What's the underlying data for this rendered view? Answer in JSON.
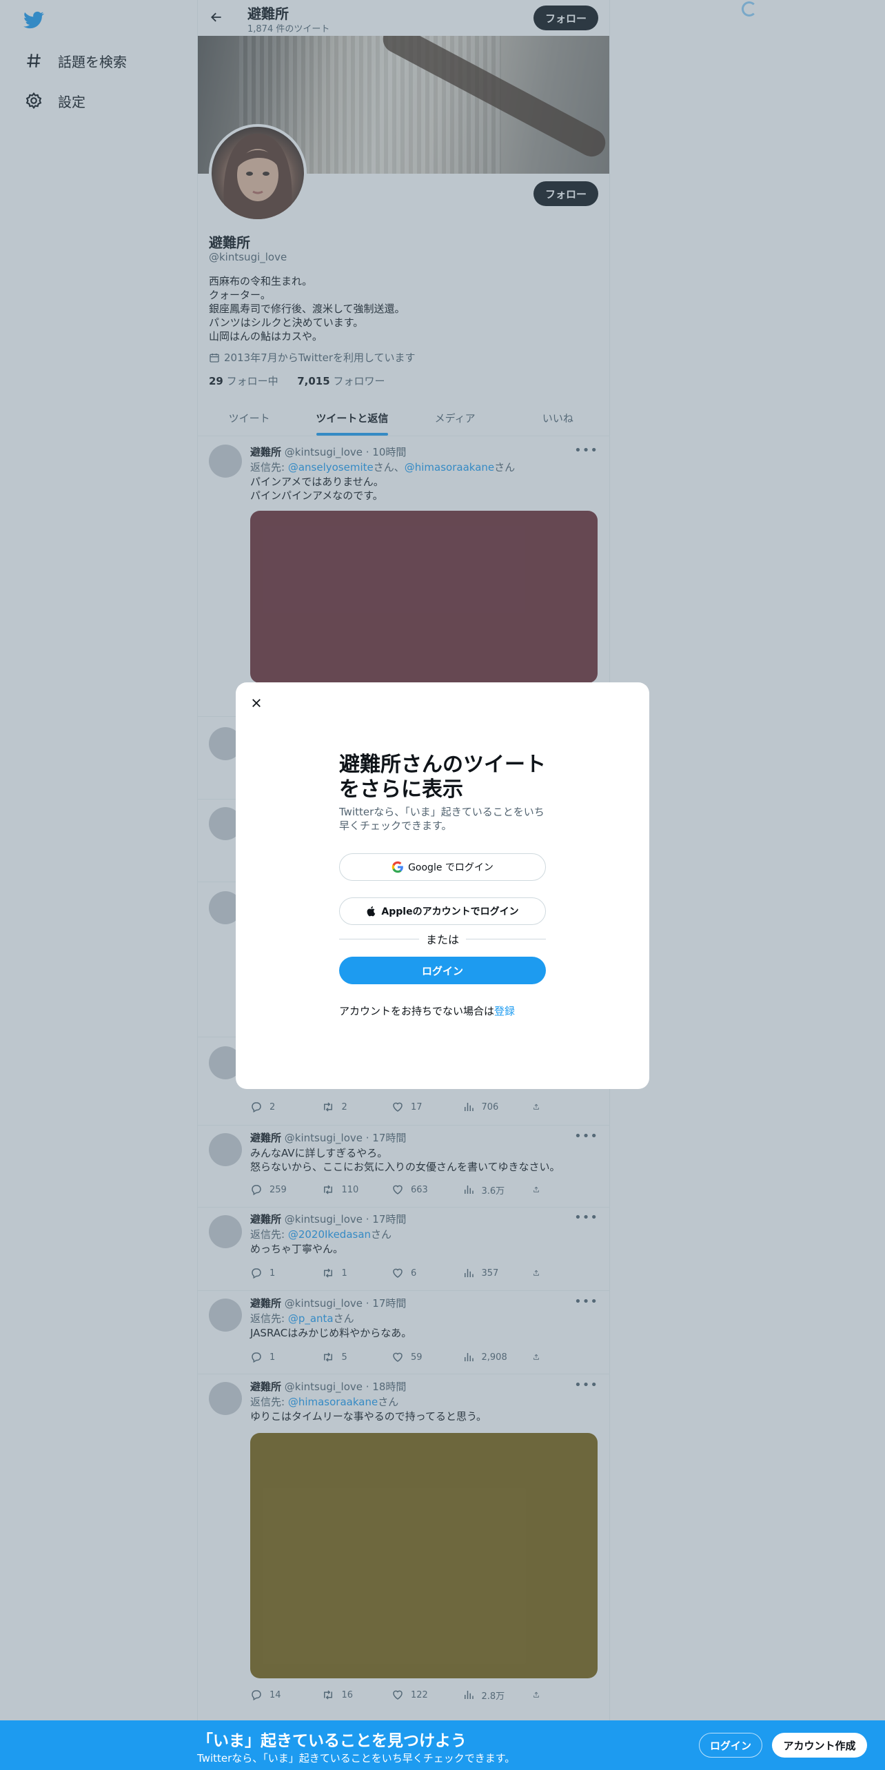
{
  "nav": {
    "items": [
      {
        "label": "話題を検索",
        "icon": "hashtag-icon"
      },
      {
        "label": "設定",
        "icon": "gear-icon"
      }
    ]
  },
  "header": {
    "name": "避難所",
    "tweet_count": "1,874 件のツイート",
    "follow_label": "フォロー"
  },
  "profile": {
    "name": "避難所",
    "handle": "@kintsugi_love",
    "bio": "西麻布の令和生まれ。\nクォーター。\n銀座鳳寿司で修行後、渡米して強制送還。\nパンツはシルクと決めています。\n山岡はんの鮎はカスや。",
    "joined": "2013年7月からTwitterを利用しています",
    "following_count": "29",
    "following_label": " フォロー中",
    "followers_count": "7,015",
    "followers_label": " フォロワー",
    "follow_label": "フォロー"
  },
  "tabs": [
    "ツイート",
    "ツイートと返信",
    "メディア",
    "いいね"
  ],
  "tweets": [
    {
      "name": "避難所",
      "meta": "@kintsugi_love · 10時間",
      "reply_prefix": "返信先: ",
      "reply_to": "@anselyosemite",
      "reply_mid": "さん、",
      "reply_to2": "@himasoraakane",
      "reply_suffix": "さん",
      "text": "パインアメではありません。\nパインパインアメなのです。",
      "media_color": "#6e2d33"
    },
    {
      "text_partial": "",
      "replies": "2",
      "retweets": "2",
      "likes": "17",
      "views": "706"
    },
    {
      "name": "避難所",
      "meta": "@kintsugi_love · 17時間",
      "text": "みんなAVに詳しすぎるやろ。\n怒らないから、ここにお気に入りの女優さんを書いてゆきなさい。",
      "replies": "259",
      "retweets": "110",
      "likes": "663",
      "views": "3.6万"
    },
    {
      "name": "避難所",
      "meta": "@kintsugi_love · 17時間",
      "reply_prefix": "返信先: ",
      "reply_to": "@2020Ikedasan",
      "reply_suffix": "さん",
      "text": "めっちゃ丁寧やん。",
      "replies": "1",
      "retweets": "1",
      "likes": "6",
      "views": "357"
    },
    {
      "name": "避難所",
      "meta": "@kintsugi_love · 17時間",
      "reply_prefix": "返信先: ",
      "reply_to": "@p_anta",
      "reply_suffix": "さん",
      "text": "JASRACはみかじめ料やからなあ。",
      "replies": "1",
      "retweets": "5",
      "likes": "59",
      "views": "2,908"
    },
    {
      "name": "避難所",
      "meta": "@kintsugi_love · 18時間",
      "reply_prefix": "返信先: ",
      "reply_to": "@himasoraakane",
      "reply_suffix": "さん",
      "text": "ゆりこはタイムリーな事やるので持ってると思う。",
      "media_color": "#7a6210",
      "replies": "14",
      "retweets": "16",
      "likes": "122",
      "views": "2.8万"
    }
  ],
  "modal": {
    "title": "避難所さんのツイートをさらに表示",
    "subtitle": "Twitterなら、「いま」起きていることをいち早くチェックできます。",
    "google_label": "Google でログイン",
    "apple_label": "Appleのアカウントでログイン",
    "or_label": "または",
    "login_label": "ログイン",
    "signup_text": "アカウントをお持ちでない場合は",
    "signup_link": "登録"
  },
  "bottom_bar": {
    "title": "「いま」起きていることを見つけよう",
    "subtitle": "Twitterなら、「いま」起きていることをいち早くチェックできます。",
    "login_label": "ログイン",
    "signup_label": "アカウント作成"
  },
  "colors": {
    "accent": "#1d9bf0",
    "text": "#0f1419",
    "muted": "#536471"
  }
}
